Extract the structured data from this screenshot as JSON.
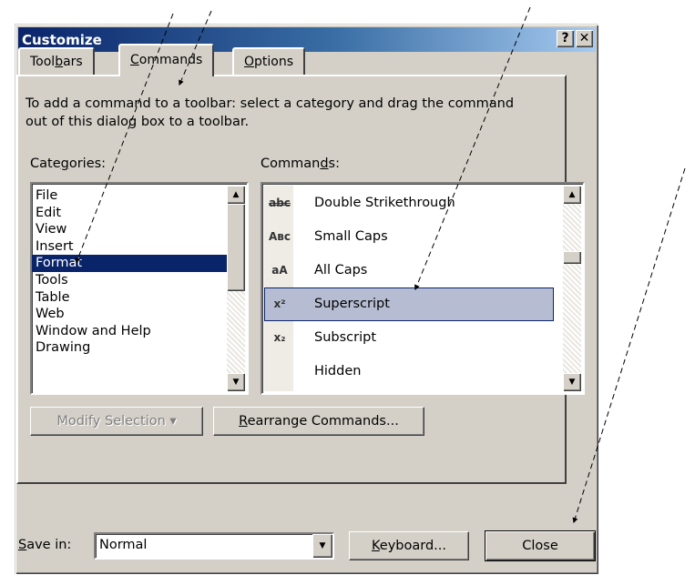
{
  "window": {
    "title": "Customize",
    "help_label": "?",
    "close_label": "✕"
  },
  "tabs": [
    {
      "pre": "Tool",
      "key": "b",
      "post": "ars"
    },
    {
      "pre": "",
      "key": "C",
      "post": "ommands"
    },
    {
      "pre": "",
      "key": "O",
      "post": "ptions"
    }
  ],
  "instructions": "To add a command to a toolbar: select a category and drag the command out of this dialog box to a toolbar.",
  "categories_label": {
    "pre": "Cate",
    "key": "g",
    "post": "ories:"
  },
  "commands_label": {
    "pre": "Comman",
    "key": "d",
    "post": "s:"
  },
  "categories": [
    "File",
    "Edit",
    "View",
    "Insert",
    "Format",
    "Tools",
    "Table",
    "Web",
    "Window and Help",
    "Drawing"
  ],
  "selected_category": "Format",
  "commands": [
    {
      "label": "Double Strikethrough",
      "icon": "double-strikethrough-icon",
      "glyph": "abc"
    },
    {
      "label": "Small Caps",
      "icon": "small-caps-icon",
      "glyph": "Aʙᴄ"
    },
    {
      "label": "All Caps",
      "icon": "all-caps-icon",
      "glyph": "aA"
    },
    {
      "label": "Superscript",
      "icon": "superscript-icon",
      "glyph": "x²"
    },
    {
      "label": "Subscript",
      "icon": "subscript-icon",
      "glyph": "x₂"
    },
    {
      "label": "Hidden",
      "icon": "hidden-icon",
      "glyph": ""
    }
  ],
  "selected_command": "Superscript",
  "buttons": {
    "modify_selection": "Modify Selection ▾",
    "rearrange": {
      "key": "R",
      "post": "earrange Commands..."
    },
    "keyboard": {
      "key": "K",
      "post": "eyboard..."
    },
    "close": "Close"
  },
  "save_in": {
    "label_key": "S",
    "label_post": "ave in:",
    "value": "Normal"
  },
  "colors": {
    "dialog_bg": "#d4d0c8",
    "title_gradient_start": "#0a246a",
    "selection": "#0a246a",
    "command_highlight": "#b6bdd2"
  }
}
